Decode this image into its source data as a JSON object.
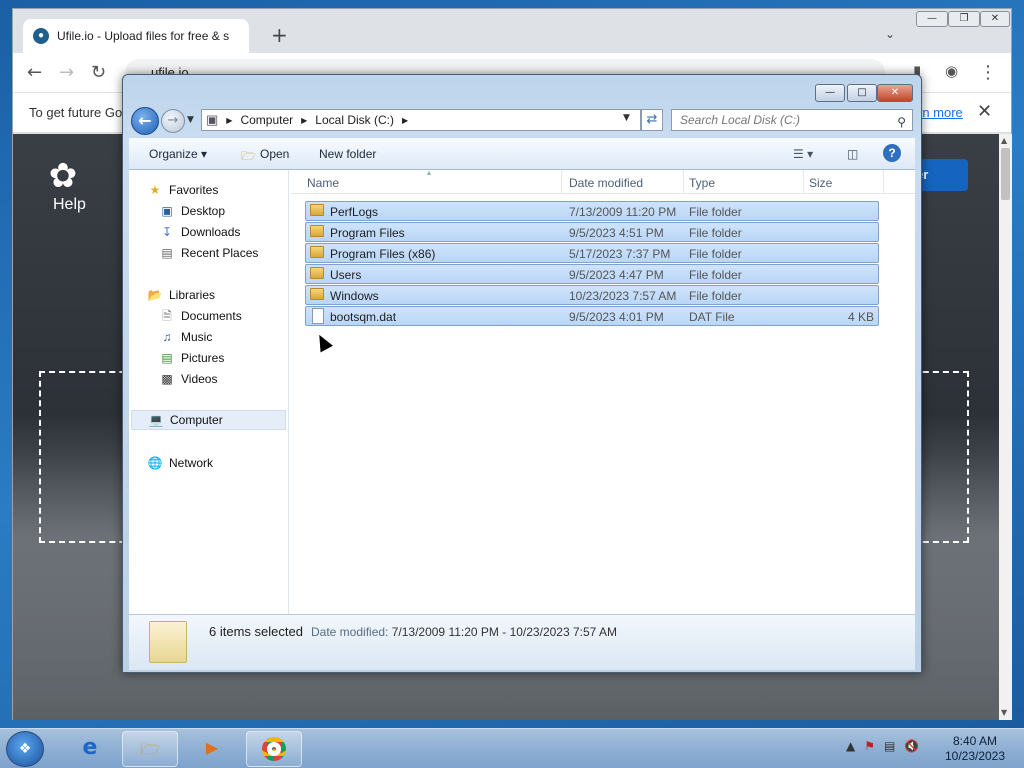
{
  "browser": {
    "tab_title": "Ufile.io - Upload files for free & s",
    "address": "ufile.io",
    "infobar_text": "To get future Go",
    "infobar_link": "rn more"
  },
  "site": {
    "help_label": "Help",
    "header_button_fragment": "er"
  },
  "explorer": {
    "breadcrumb": [
      "Computer",
      "Local Disk (C:)"
    ],
    "search_placeholder": "Search Local Disk (C:)",
    "toolbar": {
      "organize": "Organize",
      "open": "Open",
      "new_folder": "New folder"
    },
    "nav": {
      "favorites": "Favorites",
      "desktop": "Desktop",
      "downloads": "Downloads",
      "recent_places": "Recent Places",
      "libraries": "Libraries",
      "documents": "Documents",
      "music": "Music",
      "pictures": "Pictures",
      "videos": "Videos",
      "computer": "Computer",
      "network": "Network"
    },
    "columns": {
      "name": "Name",
      "date_modified": "Date modified",
      "type": "Type",
      "size": "Size"
    },
    "files": [
      {
        "name": "PerfLogs",
        "date": "7/13/2009 11:20 PM",
        "type": "File folder",
        "size": "",
        "kind": "folder"
      },
      {
        "name": "Program Files",
        "date": "9/5/2023 4:51 PM",
        "type": "File folder",
        "size": "",
        "kind": "folder"
      },
      {
        "name": "Program Files (x86)",
        "date": "5/17/2023 7:37 PM",
        "type": "File folder",
        "size": "",
        "kind": "folder"
      },
      {
        "name": "Users",
        "date": "9/5/2023 4:47 PM",
        "type": "File folder",
        "size": "",
        "kind": "folder"
      },
      {
        "name": "Windows",
        "date": "10/23/2023 7:57 AM",
        "type": "File folder",
        "size": "",
        "kind": "folder"
      },
      {
        "name": "bootsqm.dat",
        "date": "9/5/2023 4:01 PM",
        "type": "DAT File",
        "size": "4 KB",
        "kind": "file"
      }
    ],
    "status": {
      "selected": "6 items selected",
      "date_label": "Date modified:",
      "date_range": "7/13/2009 11:20 PM - 10/23/2023 7:57 AM"
    }
  },
  "taskbar": {
    "time": "8:40 AM",
    "date": "10/23/2023"
  }
}
